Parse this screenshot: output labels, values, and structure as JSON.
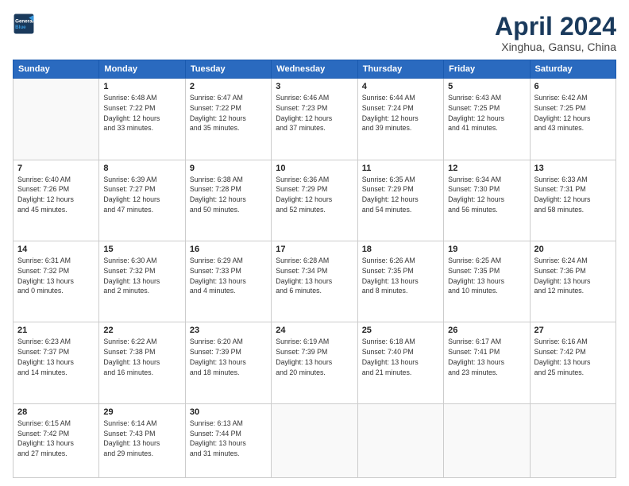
{
  "header": {
    "logo_line1": "General",
    "logo_line2": "Blue",
    "title": "April 2024",
    "subtitle": "Xinghua, Gansu, China"
  },
  "columns": [
    "Sunday",
    "Monday",
    "Tuesday",
    "Wednesday",
    "Thursday",
    "Friday",
    "Saturday"
  ],
  "weeks": [
    [
      {
        "day": "",
        "info": ""
      },
      {
        "day": "1",
        "info": "Sunrise: 6:48 AM\nSunset: 7:22 PM\nDaylight: 12 hours\nand 33 minutes."
      },
      {
        "day": "2",
        "info": "Sunrise: 6:47 AM\nSunset: 7:22 PM\nDaylight: 12 hours\nand 35 minutes."
      },
      {
        "day": "3",
        "info": "Sunrise: 6:46 AM\nSunset: 7:23 PM\nDaylight: 12 hours\nand 37 minutes."
      },
      {
        "day": "4",
        "info": "Sunrise: 6:44 AM\nSunset: 7:24 PM\nDaylight: 12 hours\nand 39 minutes."
      },
      {
        "day": "5",
        "info": "Sunrise: 6:43 AM\nSunset: 7:25 PM\nDaylight: 12 hours\nand 41 minutes."
      },
      {
        "day": "6",
        "info": "Sunrise: 6:42 AM\nSunset: 7:25 PM\nDaylight: 12 hours\nand 43 minutes."
      }
    ],
    [
      {
        "day": "7",
        "info": "Sunrise: 6:40 AM\nSunset: 7:26 PM\nDaylight: 12 hours\nand 45 minutes."
      },
      {
        "day": "8",
        "info": "Sunrise: 6:39 AM\nSunset: 7:27 PM\nDaylight: 12 hours\nand 47 minutes."
      },
      {
        "day": "9",
        "info": "Sunrise: 6:38 AM\nSunset: 7:28 PM\nDaylight: 12 hours\nand 50 minutes."
      },
      {
        "day": "10",
        "info": "Sunrise: 6:36 AM\nSunset: 7:29 PM\nDaylight: 12 hours\nand 52 minutes."
      },
      {
        "day": "11",
        "info": "Sunrise: 6:35 AM\nSunset: 7:29 PM\nDaylight: 12 hours\nand 54 minutes."
      },
      {
        "day": "12",
        "info": "Sunrise: 6:34 AM\nSunset: 7:30 PM\nDaylight: 12 hours\nand 56 minutes."
      },
      {
        "day": "13",
        "info": "Sunrise: 6:33 AM\nSunset: 7:31 PM\nDaylight: 12 hours\nand 58 minutes."
      }
    ],
    [
      {
        "day": "14",
        "info": "Sunrise: 6:31 AM\nSunset: 7:32 PM\nDaylight: 13 hours\nand 0 minutes."
      },
      {
        "day": "15",
        "info": "Sunrise: 6:30 AM\nSunset: 7:32 PM\nDaylight: 13 hours\nand 2 minutes."
      },
      {
        "day": "16",
        "info": "Sunrise: 6:29 AM\nSunset: 7:33 PM\nDaylight: 13 hours\nand 4 minutes."
      },
      {
        "day": "17",
        "info": "Sunrise: 6:28 AM\nSunset: 7:34 PM\nDaylight: 13 hours\nand 6 minutes."
      },
      {
        "day": "18",
        "info": "Sunrise: 6:26 AM\nSunset: 7:35 PM\nDaylight: 13 hours\nand 8 minutes."
      },
      {
        "day": "19",
        "info": "Sunrise: 6:25 AM\nSunset: 7:35 PM\nDaylight: 13 hours\nand 10 minutes."
      },
      {
        "day": "20",
        "info": "Sunrise: 6:24 AM\nSunset: 7:36 PM\nDaylight: 13 hours\nand 12 minutes."
      }
    ],
    [
      {
        "day": "21",
        "info": "Sunrise: 6:23 AM\nSunset: 7:37 PM\nDaylight: 13 hours\nand 14 minutes."
      },
      {
        "day": "22",
        "info": "Sunrise: 6:22 AM\nSunset: 7:38 PM\nDaylight: 13 hours\nand 16 minutes."
      },
      {
        "day": "23",
        "info": "Sunrise: 6:20 AM\nSunset: 7:39 PM\nDaylight: 13 hours\nand 18 minutes."
      },
      {
        "day": "24",
        "info": "Sunrise: 6:19 AM\nSunset: 7:39 PM\nDaylight: 13 hours\nand 20 minutes."
      },
      {
        "day": "25",
        "info": "Sunrise: 6:18 AM\nSunset: 7:40 PM\nDaylight: 13 hours\nand 21 minutes."
      },
      {
        "day": "26",
        "info": "Sunrise: 6:17 AM\nSunset: 7:41 PM\nDaylight: 13 hours\nand 23 minutes."
      },
      {
        "day": "27",
        "info": "Sunrise: 6:16 AM\nSunset: 7:42 PM\nDaylight: 13 hours\nand 25 minutes."
      }
    ],
    [
      {
        "day": "28",
        "info": "Sunrise: 6:15 AM\nSunset: 7:42 PM\nDaylight: 13 hours\nand 27 minutes."
      },
      {
        "day": "29",
        "info": "Sunrise: 6:14 AM\nSunset: 7:43 PM\nDaylight: 13 hours\nand 29 minutes."
      },
      {
        "day": "30",
        "info": "Sunrise: 6:13 AM\nSunset: 7:44 PM\nDaylight: 13 hours\nand 31 minutes."
      },
      {
        "day": "",
        "info": ""
      },
      {
        "day": "",
        "info": ""
      },
      {
        "day": "",
        "info": ""
      },
      {
        "day": "",
        "info": ""
      }
    ]
  ]
}
